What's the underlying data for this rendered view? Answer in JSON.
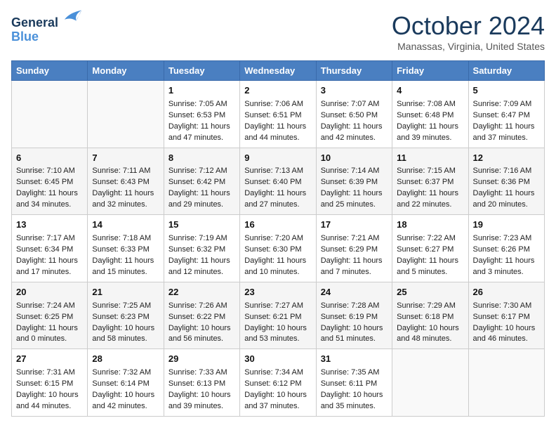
{
  "header": {
    "logo_line1": "General",
    "logo_line2": "Blue",
    "month": "October 2024",
    "location": "Manassas, Virginia, United States"
  },
  "days_of_week": [
    "Sunday",
    "Monday",
    "Tuesday",
    "Wednesday",
    "Thursday",
    "Friday",
    "Saturday"
  ],
  "weeks": [
    [
      {
        "day": "",
        "sunrise": "",
        "sunset": "",
        "daylight": ""
      },
      {
        "day": "",
        "sunrise": "",
        "sunset": "",
        "daylight": ""
      },
      {
        "day": "1",
        "sunrise": "Sunrise: 7:05 AM",
        "sunset": "Sunset: 6:53 PM",
        "daylight": "Daylight: 11 hours and 47 minutes."
      },
      {
        "day": "2",
        "sunrise": "Sunrise: 7:06 AM",
        "sunset": "Sunset: 6:51 PM",
        "daylight": "Daylight: 11 hours and 44 minutes."
      },
      {
        "day": "3",
        "sunrise": "Sunrise: 7:07 AM",
        "sunset": "Sunset: 6:50 PM",
        "daylight": "Daylight: 11 hours and 42 minutes."
      },
      {
        "day": "4",
        "sunrise": "Sunrise: 7:08 AM",
        "sunset": "Sunset: 6:48 PM",
        "daylight": "Daylight: 11 hours and 39 minutes."
      },
      {
        "day": "5",
        "sunrise": "Sunrise: 7:09 AM",
        "sunset": "Sunset: 6:47 PM",
        "daylight": "Daylight: 11 hours and 37 minutes."
      }
    ],
    [
      {
        "day": "6",
        "sunrise": "Sunrise: 7:10 AM",
        "sunset": "Sunset: 6:45 PM",
        "daylight": "Daylight: 11 hours and 34 minutes."
      },
      {
        "day": "7",
        "sunrise": "Sunrise: 7:11 AM",
        "sunset": "Sunset: 6:43 PM",
        "daylight": "Daylight: 11 hours and 32 minutes."
      },
      {
        "day": "8",
        "sunrise": "Sunrise: 7:12 AM",
        "sunset": "Sunset: 6:42 PM",
        "daylight": "Daylight: 11 hours and 29 minutes."
      },
      {
        "day": "9",
        "sunrise": "Sunrise: 7:13 AM",
        "sunset": "Sunset: 6:40 PM",
        "daylight": "Daylight: 11 hours and 27 minutes."
      },
      {
        "day": "10",
        "sunrise": "Sunrise: 7:14 AM",
        "sunset": "Sunset: 6:39 PM",
        "daylight": "Daylight: 11 hours and 25 minutes."
      },
      {
        "day": "11",
        "sunrise": "Sunrise: 7:15 AM",
        "sunset": "Sunset: 6:37 PM",
        "daylight": "Daylight: 11 hours and 22 minutes."
      },
      {
        "day": "12",
        "sunrise": "Sunrise: 7:16 AM",
        "sunset": "Sunset: 6:36 PM",
        "daylight": "Daylight: 11 hours and 20 minutes."
      }
    ],
    [
      {
        "day": "13",
        "sunrise": "Sunrise: 7:17 AM",
        "sunset": "Sunset: 6:34 PM",
        "daylight": "Daylight: 11 hours and 17 minutes."
      },
      {
        "day": "14",
        "sunrise": "Sunrise: 7:18 AM",
        "sunset": "Sunset: 6:33 PM",
        "daylight": "Daylight: 11 hours and 15 minutes."
      },
      {
        "day": "15",
        "sunrise": "Sunrise: 7:19 AM",
        "sunset": "Sunset: 6:32 PM",
        "daylight": "Daylight: 11 hours and 12 minutes."
      },
      {
        "day": "16",
        "sunrise": "Sunrise: 7:20 AM",
        "sunset": "Sunset: 6:30 PM",
        "daylight": "Daylight: 11 hours and 10 minutes."
      },
      {
        "day": "17",
        "sunrise": "Sunrise: 7:21 AM",
        "sunset": "Sunset: 6:29 PM",
        "daylight": "Daylight: 11 hours and 7 minutes."
      },
      {
        "day": "18",
        "sunrise": "Sunrise: 7:22 AM",
        "sunset": "Sunset: 6:27 PM",
        "daylight": "Daylight: 11 hours and 5 minutes."
      },
      {
        "day": "19",
        "sunrise": "Sunrise: 7:23 AM",
        "sunset": "Sunset: 6:26 PM",
        "daylight": "Daylight: 11 hours and 3 minutes."
      }
    ],
    [
      {
        "day": "20",
        "sunrise": "Sunrise: 7:24 AM",
        "sunset": "Sunset: 6:25 PM",
        "daylight": "Daylight: 11 hours and 0 minutes."
      },
      {
        "day": "21",
        "sunrise": "Sunrise: 7:25 AM",
        "sunset": "Sunset: 6:23 PM",
        "daylight": "Daylight: 10 hours and 58 minutes."
      },
      {
        "day": "22",
        "sunrise": "Sunrise: 7:26 AM",
        "sunset": "Sunset: 6:22 PM",
        "daylight": "Daylight: 10 hours and 56 minutes."
      },
      {
        "day": "23",
        "sunrise": "Sunrise: 7:27 AM",
        "sunset": "Sunset: 6:21 PM",
        "daylight": "Daylight: 10 hours and 53 minutes."
      },
      {
        "day": "24",
        "sunrise": "Sunrise: 7:28 AM",
        "sunset": "Sunset: 6:19 PM",
        "daylight": "Daylight: 10 hours and 51 minutes."
      },
      {
        "day": "25",
        "sunrise": "Sunrise: 7:29 AM",
        "sunset": "Sunset: 6:18 PM",
        "daylight": "Daylight: 10 hours and 48 minutes."
      },
      {
        "day": "26",
        "sunrise": "Sunrise: 7:30 AM",
        "sunset": "Sunset: 6:17 PM",
        "daylight": "Daylight: 10 hours and 46 minutes."
      }
    ],
    [
      {
        "day": "27",
        "sunrise": "Sunrise: 7:31 AM",
        "sunset": "Sunset: 6:15 PM",
        "daylight": "Daylight: 10 hours and 44 minutes."
      },
      {
        "day": "28",
        "sunrise": "Sunrise: 7:32 AM",
        "sunset": "Sunset: 6:14 PM",
        "daylight": "Daylight: 10 hours and 42 minutes."
      },
      {
        "day": "29",
        "sunrise": "Sunrise: 7:33 AM",
        "sunset": "Sunset: 6:13 PM",
        "daylight": "Daylight: 10 hours and 39 minutes."
      },
      {
        "day": "30",
        "sunrise": "Sunrise: 7:34 AM",
        "sunset": "Sunset: 6:12 PM",
        "daylight": "Daylight: 10 hours and 37 minutes."
      },
      {
        "day": "31",
        "sunrise": "Sunrise: 7:35 AM",
        "sunset": "Sunset: 6:11 PM",
        "daylight": "Daylight: 10 hours and 35 minutes."
      },
      {
        "day": "",
        "sunrise": "",
        "sunset": "",
        "daylight": ""
      },
      {
        "day": "",
        "sunrise": "",
        "sunset": "",
        "daylight": ""
      }
    ]
  ]
}
